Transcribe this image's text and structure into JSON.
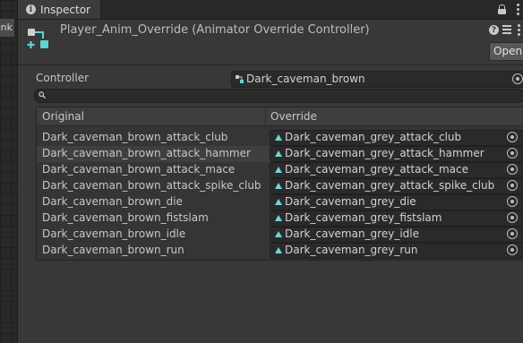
{
  "side_panel": {
    "tab_label": "nk"
  },
  "tabbar": {
    "tab_label": "Inspector"
  },
  "header": {
    "title": "Player_Anim_Override (Animator Override Controller)",
    "open_label": "Open",
    "help_glyph": "?"
  },
  "controller": {
    "label": "Controller",
    "value": "Dark_caveman_brown"
  },
  "search": {
    "placeholder": ""
  },
  "list": {
    "col_original": "Original",
    "col_override": "Override",
    "rows": [
      {
        "original": "Dark_caveman_brown_attack_club",
        "override": "Dark_caveman_grey_attack_club"
      },
      {
        "original": "Dark_caveman_brown_attack_hammer",
        "override": "Dark_caveman_grey_attack_hammer"
      },
      {
        "original": "Dark_caveman_brown_attack_mace",
        "override": "Dark_caveman_grey_attack_mace"
      },
      {
        "original": "Dark_caveman_brown_attack_spike_club",
        "override": "Dark_caveman_grey_attack_spike_club"
      },
      {
        "original": "Dark_caveman_brown_die",
        "override": "Dark_caveman_grey_die"
      },
      {
        "original": "Dark_caveman_brown_fistslam",
        "override": "Dark_caveman_grey_fistslam"
      },
      {
        "original": "Dark_caveman_brown_idle",
        "override": "Dark_caveman_grey_idle"
      },
      {
        "original": "Dark_caveman_brown_run",
        "override": "Dark_caveman_grey_run"
      }
    ]
  },
  "icons": {
    "tab": "info-icon",
    "asset": "animator-override-controller-icon",
    "controller_field": "animator-controller-icon",
    "override_field": "animation-clip-icon",
    "picker": "object-picker-icon",
    "search": "search-icon",
    "lock": "lock-icon",
    "menu": "kebab-menu-icon",
    "help": "help-icon",
    "presets": "presets-icon"
  },
  "colors": {
    "background": "#383838",
    "field": "#2a2a2a",
    "clip_icon": "#6fd7d2",
    "asset_icon": "#5fd3cf",
    "text": "#c4c4c4"
  },
  "state": {
    "highlighted_row": 1
  }
}
